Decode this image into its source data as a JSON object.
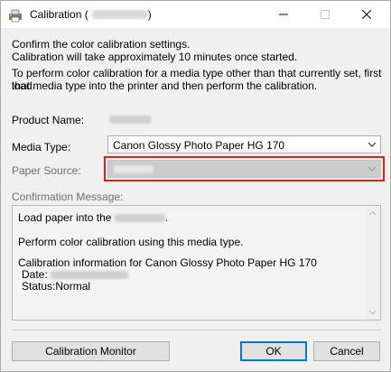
{
  "window": {
    "title": "Calibration",
    "title_suffix_open": "(",
    "title_suffix_close": ")"
  },
  "intro": {
    "line1": "Confirm the color calibration settings.",
    "line2": "Calibration will take approximately 10 minutes once started.",
    "line3": "To perform color calibration for a media type other than that currently set, first load",
    "line4": "that media type into the printer and then perform the calibration."
  },
  "form": {
    "product_name_label": "Product Name:",
    "media_type_label": "Media Type:",
    "media_type_value": "Canon Glossy Photo Paper HG 170",
    "paper_source_label": "Paper Source:",
    "confirmation_label": "Confirmation Message:"
  },
  "message": {
    "line1_prefix": "Load paper into the",
    "line1_suffix": ".",
    "line2": "Perform color calibration using this media type.",
    "line3": "Calibration information for Canon Glossy Photo Paper HG 170",
    "date_label": "Date:",
    "status_label": "Status:",
    "status_value": "Normal"
  },
  "buttons": {
    "calibration_monitor": "Calibration Monitor",
    "ok": "OK",
    "cancel": "Cancel"
  },
  "colors": {
    "highlight": "#e0201e",
    "accent": "#0078d7"
  }
}
